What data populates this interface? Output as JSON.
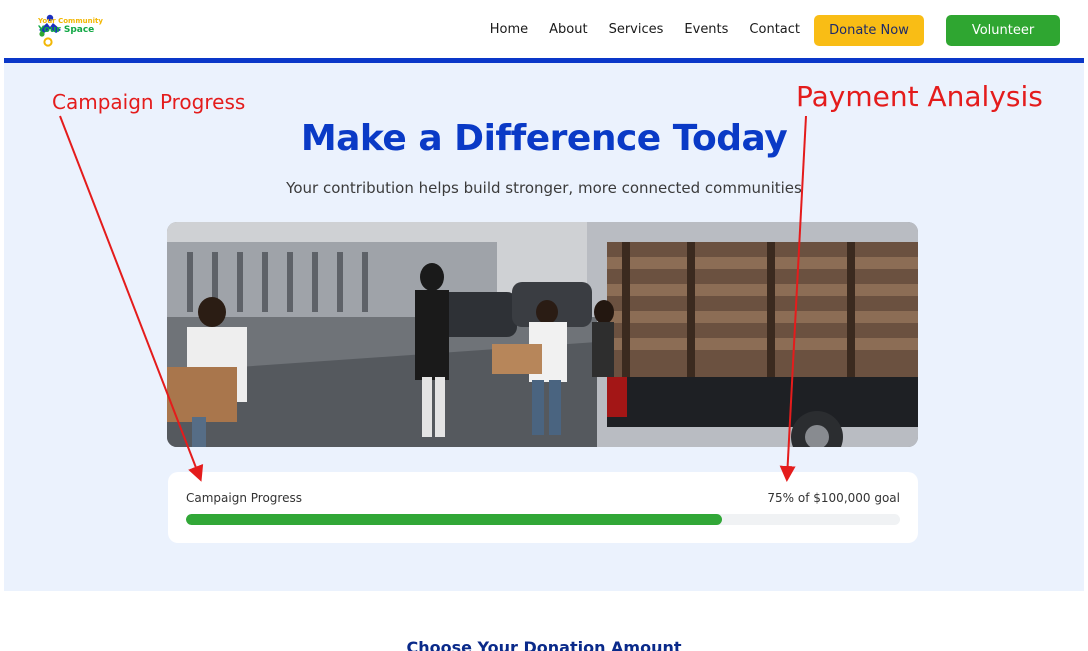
{
  "nav": {
    "logo_line1": "Your Community",
    "logo_line2": "Your Space",
    "links": [
      "Home",
      "About",
      "Services",
      "Events",
      "Contact"
    ],
    "donate_label": "Donate Now",
    "volunteer_label": "Volunteer"
  },
  "hero": {
    "title": "Make a Difference Today",
    "subtitle": "Your contribution helps build stronger, more connected communities"
  },
  "progress": {
    "label": "Campaign Progress",
    "goal_text": "75% of $100,000 goal",
    "percent": 75
  },
  "lower": {
    "heading": "Choose Your Donation Amount"
  },
  "annotations": {
    "left": "Campaign Progress",
    "right": "Payment Analysis"
  },
  "colors": {
    "brand_blue": "#0a3ac6",
    "donate_yellow": "#f9bd15",
    "volunteer_green": "#2fa631",
    "progress_green": "#31a737",
    "annotation_red": "#e41c1c"
  }
}
